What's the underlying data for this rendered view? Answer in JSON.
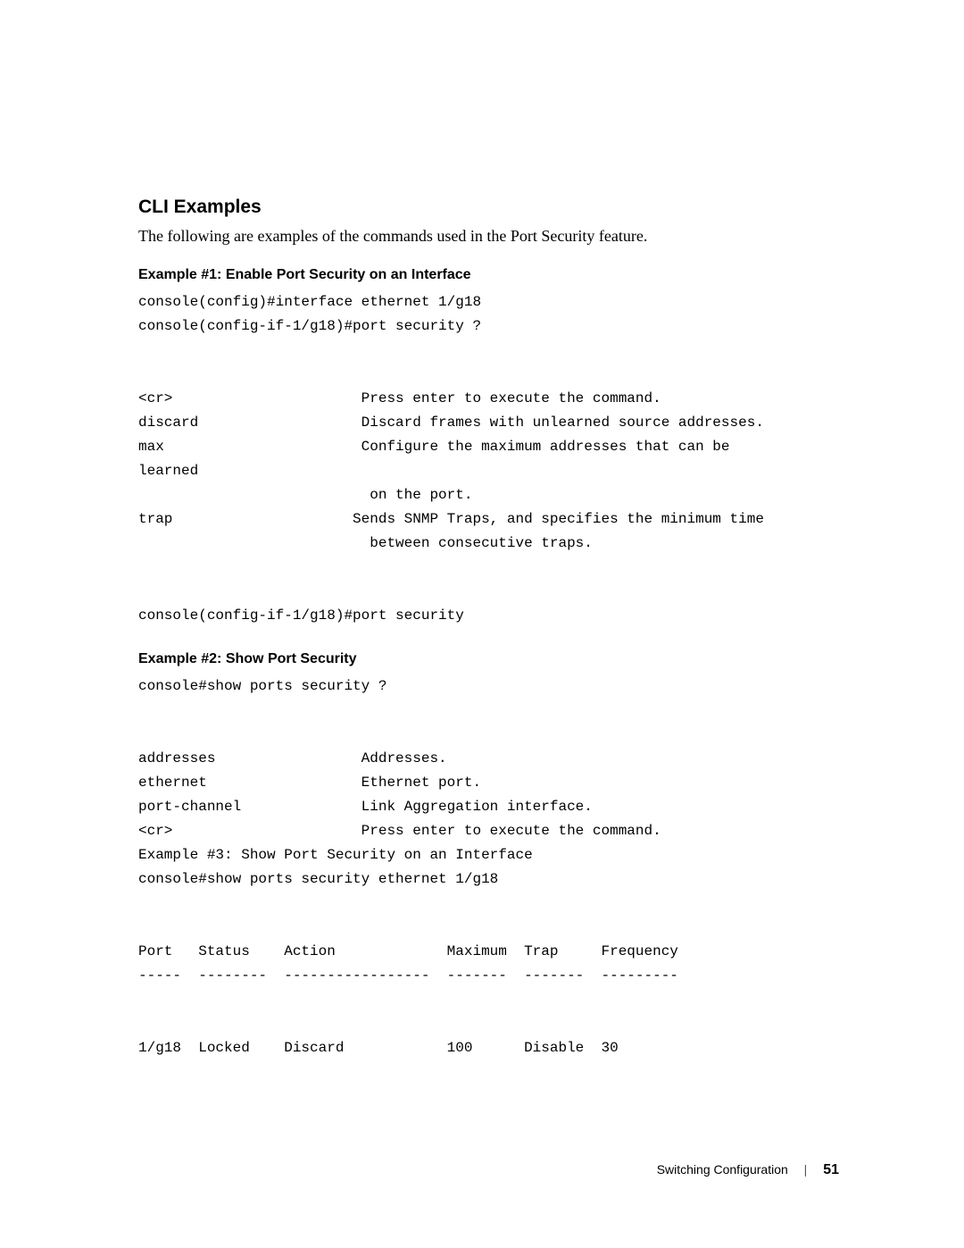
{
  "section": {
    "heading": "CLI Examples",
    "intro": "The following are examples of the commands used in the Port Security feature."
  },
  "example1": {
    "heading": "Example #1: Enable Port Security on an Interface",
    "code": "console(config)#interface ethernet 1/g18\nconsole(config-if-1/g18)#port security ?\n\n\n<cr>                      Press enter to execute the command.\ndiscard                   Discard frames with unlearned source addresses.\nmax                       Configure the maximum addresses that can be\nlearned\n                           on the port.\ntrap                     Sends SNMP Traps, and specifies the minimum time\n                           between consecutive traps.\n\n\nconsole(config-if-1/g18)#port security"
  },
  "example2": {
    "heading": "Example #2: Show Port Security",
    "code": "console#show ports security ?\n\n\naddresses                 Addresses.\nethernet                  Ethernet port.\nport-channel              Link Aggregation interface.\n<cr>                      Press enter to execute the command.\nExample #3: Show Port Security on an Interface\nconsole#show ports security ethernet 1/g18\n\n\nPort   Status    Action             Maximum  Trap     Frequency\n-----  --------  -----------------  -------  -------  ---------\n\n\n1/g18  Locked    Discard            100      Disable  30"
  },
  "footer": {
    "title": "Switching Configuration",
    "page": "51"
  }
}
